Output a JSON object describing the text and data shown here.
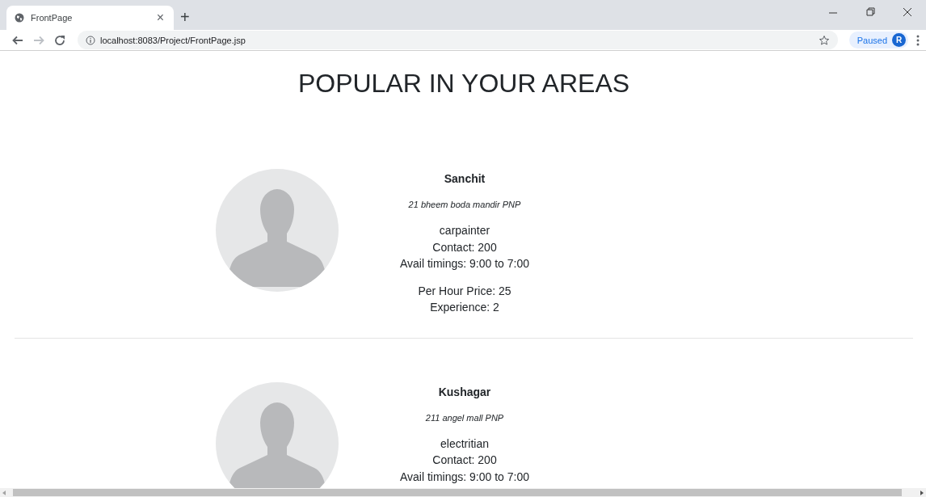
{
  "browser": {
    "tab": {
      "title": "FrontPage",
      "close": "×"
    },
    "new_tab": "+",
    "address": "localhost:8083/Project/FrontPage.jsp",
    "profile": {
      "status": "Paused",
      "initial": "R"
    }
  },
  "page": {
    "heading": "POPULAR IN YOUR AREAS",
    "cards": [
      {
        "name": "Sanchit",
        "address": "21 bheem boda mandir PNP",
        "lines": [
          "carpainter",
          "Contact: 200",
          "Avail timings: 9:00 to 7:00"
        ],
        "extra": [
          "Per Hour Price: 25",
          "Experience: 2"
        ]
      },
      {
        "name": "Kushagar",
        "address": "211 angel mall PNP",
        "lines": [
          "electritian",
          "Contact: 200",
          "Avail timings: 9:00 to 7:00"
        ]
      }
    ]
  }
}
